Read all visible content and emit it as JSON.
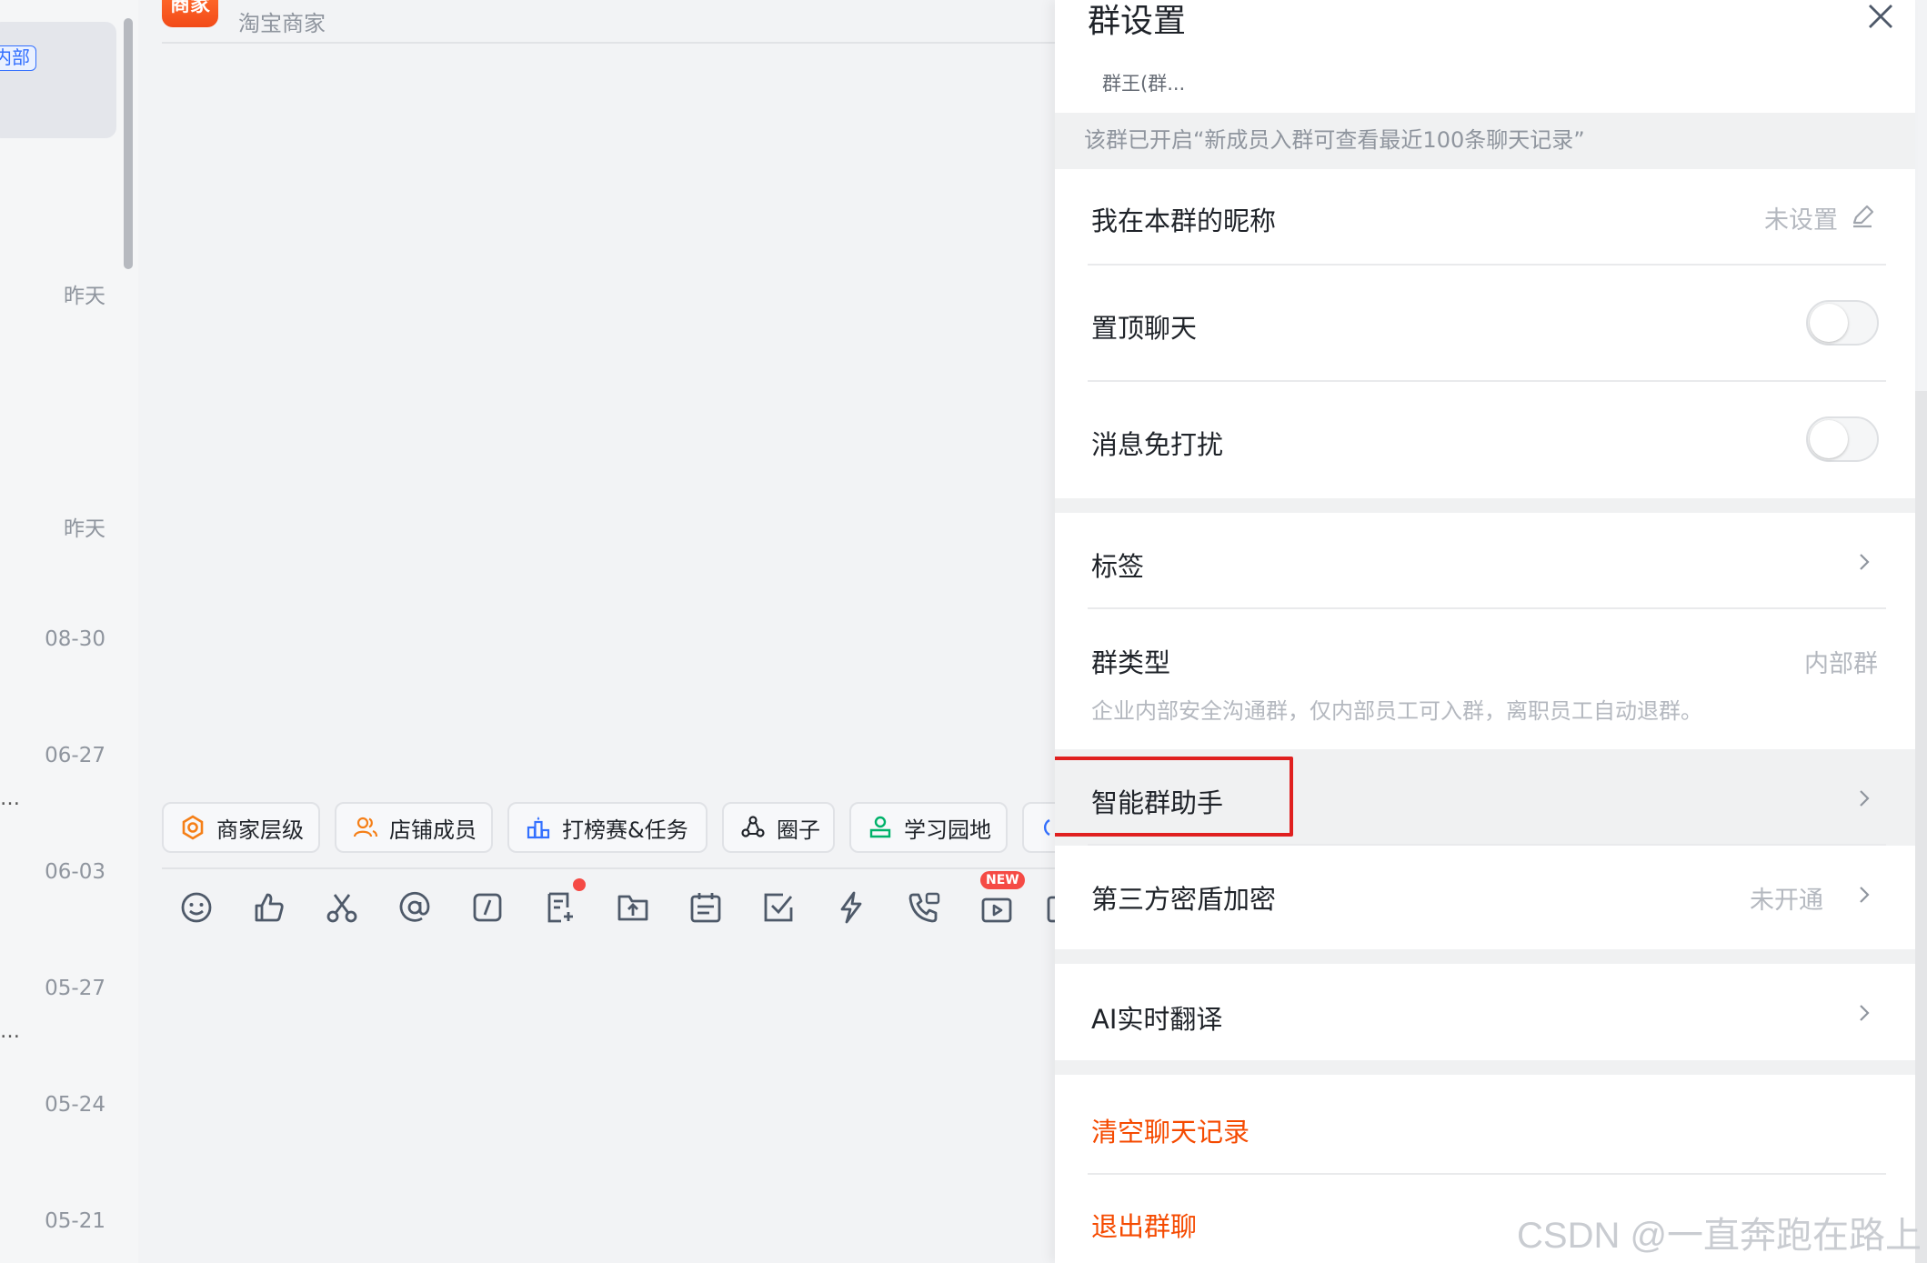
{
  "conversation_list": {
    "active_item_tag": "内部",
    "dates": [
      "昨天",
      "昨天",
      "08-30",
      "06-27",
      "06-03",
      "05-27",
      "05-24",
      "05-21"
    ],
    "truncation": "…"
  },
  "chat": {
    "store_logo_text": "商家",
    "subtitle": "淘宝商家",
    "shortcuts": [
      {
        "label": "商家层级",
        "icon": "medal-icon",
        "color": "#f57f17"
      },
      {
        "label": "店铺成员",
        "icon": "members-icon",
        "color": "#f57f17"
      },
      {
        "label": "打榜赛&任务",
        "icon": "podium-icon",
        "color": "#3370ff"
      },
      {
        "label": "圈子",
        "icon": "circle-group-icon",
        "color": "#1f2329"
      },
      {
        "label": "学习园地",
        "icon": "learning-icon",
        "color": "#00b26a"
      }
    ],
    "toolbar": [
      {
        "icon": "emoji-icon"
      },
      {
        "icon": "thumbs-up-icon"
      },
      {
        "icon": "scissors-icon"
      },
      {
        "icon": "mention-icon"
      },
      {
        "icon": "slash-command-icon"
      },
      {
        "icon": "new-doc-icon",
        "dot": true
      },
      {
        "icon": "upload-file-icon"
      },
      {
        "icon": "calendar-icon"
      },
      {
        "icon": "task-check-icon"
      },
      {
        "icon": "lightning-icon"
      },
      {
        "icon": "phone-call-icon"
      },
      {
        "icon": "live-video-icon",
        "badge": "NEW"
      },
      {
        "icon": "more-icon"
      }
    ]
  },
  "panel": {
    "title": "群设置",
    "owner_line": "群王(群...",
    "notice": "该群已开启“新成员入群可查看最近100条聊天记录”",
    "nickname": {
      "label": "我在本群的昵称",
      "value": "未设置"
    },
    "pin_chat": {
      "label": "置顶聊天",
      "on": false
    },
    "mute": {
      "label": "消息免打扰",
      "on": false
    },
    "tags": {
      "label": "标签"
    },
    "group_type": {
      "label": "群类型",
      "value": "内部群",
      "description": "企业内部安全沟通群，仅内部员工可入群，离职员工自动退群。"
    },
    "assistant": {
      "label": "智能群助手",
      "highlighted": true,
      "highlight_color": "#e02020"
    },
    "encryption": {
      "label": "第三方密盾加密",
      "value": "未开通"
    },
    "translate": {
      "label": "AI实时翻译"
    },
    "clear_history": {
      "label": "清空聊天记录"
    },
    "leave_group": {
      "label": "退出群聊"
    },
    "danger_color": "#f54a00"
  },
  "watermark": "CSDN @一直奔跑在路上"
}
